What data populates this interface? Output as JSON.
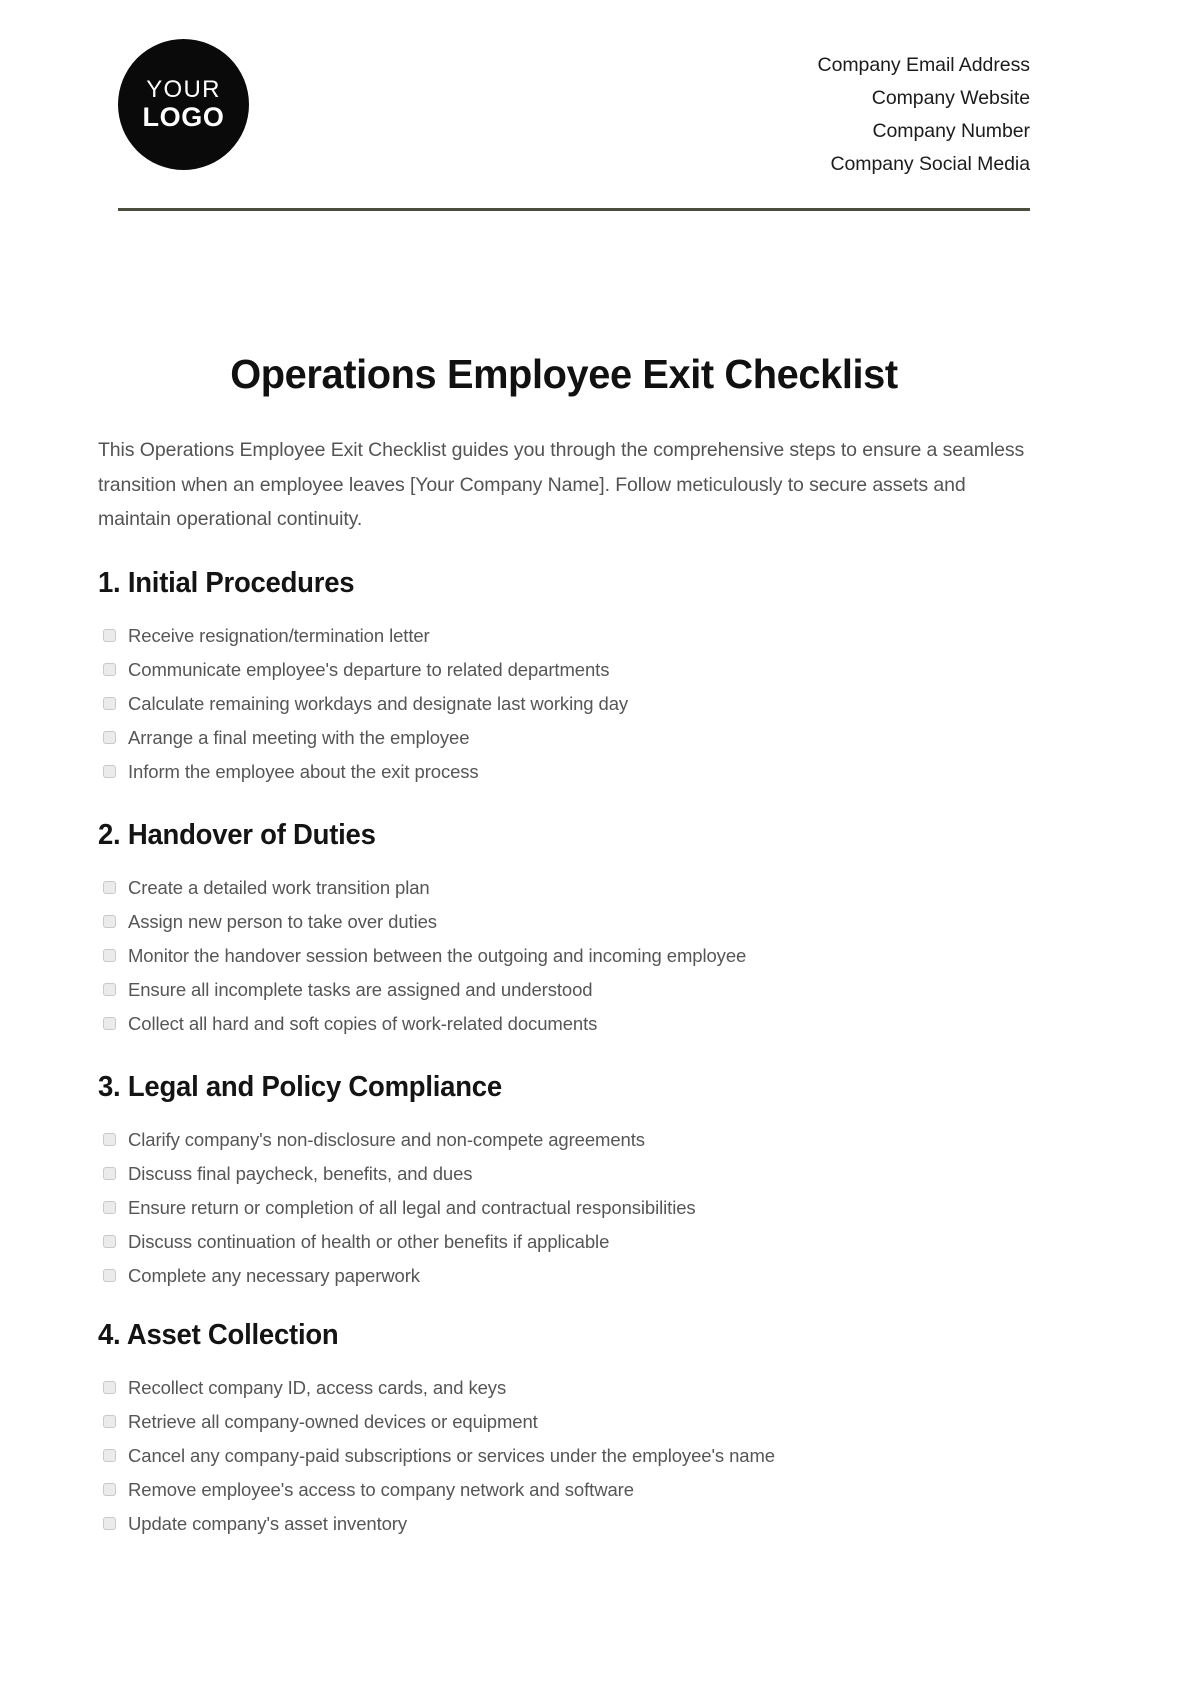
{
  "header": {
    "logo": {
      "line1": "YOUR",
      "line2": "LOGO"
    },
    "contact_lines": [
      "Company Email Address",
      "Company Website",
      "Company Number",
      "Company Social Media"
    ],
    "rule_color": "#4d4d3f"
  },
  "document": {
    "title": "Operations Employee Exit Checklist",
    "intro": "This Operations Employee Exit Checklist guides you through the comprehensive steps to ensure a seamless transition when an employee leaves [Your Company Name]. Follow meticulously to secure assets and maintain operational continuity."
  },
  "sections": [
    {
      "heading": "1. Initial Procedures",
      "items": [
        "Receive resignation/termination letter",
        "Communicate employee's departure to related departments",
        "Calculate remaining workdays and designate last working day",
        "Arrange a final meeting with the employee",
        "Inform the employee about the exit process"
      ]
    },
    {
      "heading": "2. Handover of Duties",
      "items": [
        "Create a detailed work transition plan",
        "Assign new person to take over duties",
        "Monitor the handover session between the outgoing and incoming employee",
        "Ensure all incomplete tasks are assigned and understood",
        "Collect all hard and soft copies of work-related documents"
      ]
    },
    {
      "heading": "3. Legal and Policy Compliance",
      "items": [
        "Clarify company's non-disclosure and non-compete agreements",
        "Discuss final paycheck, benefits, and dues",
        "Ensure return or completion of all legal and contractual responsibilities",
        "Discuss continuation of health or other benefits if applicable",
        "Complete any necessary paperwork"
      ]
    },
    {
      "heading": "4. Asset Collection",
      "items": [
        "Recollect company ID, access cards, and keys",
        "Retrieve all company-owned devices or equipment",
        "Cancel any company-paid subscriptions or services under the employee's name",
        "Remove employee's access to company network and software",
        "Update company's asset inventory"
      ]
    }
  ]
}
